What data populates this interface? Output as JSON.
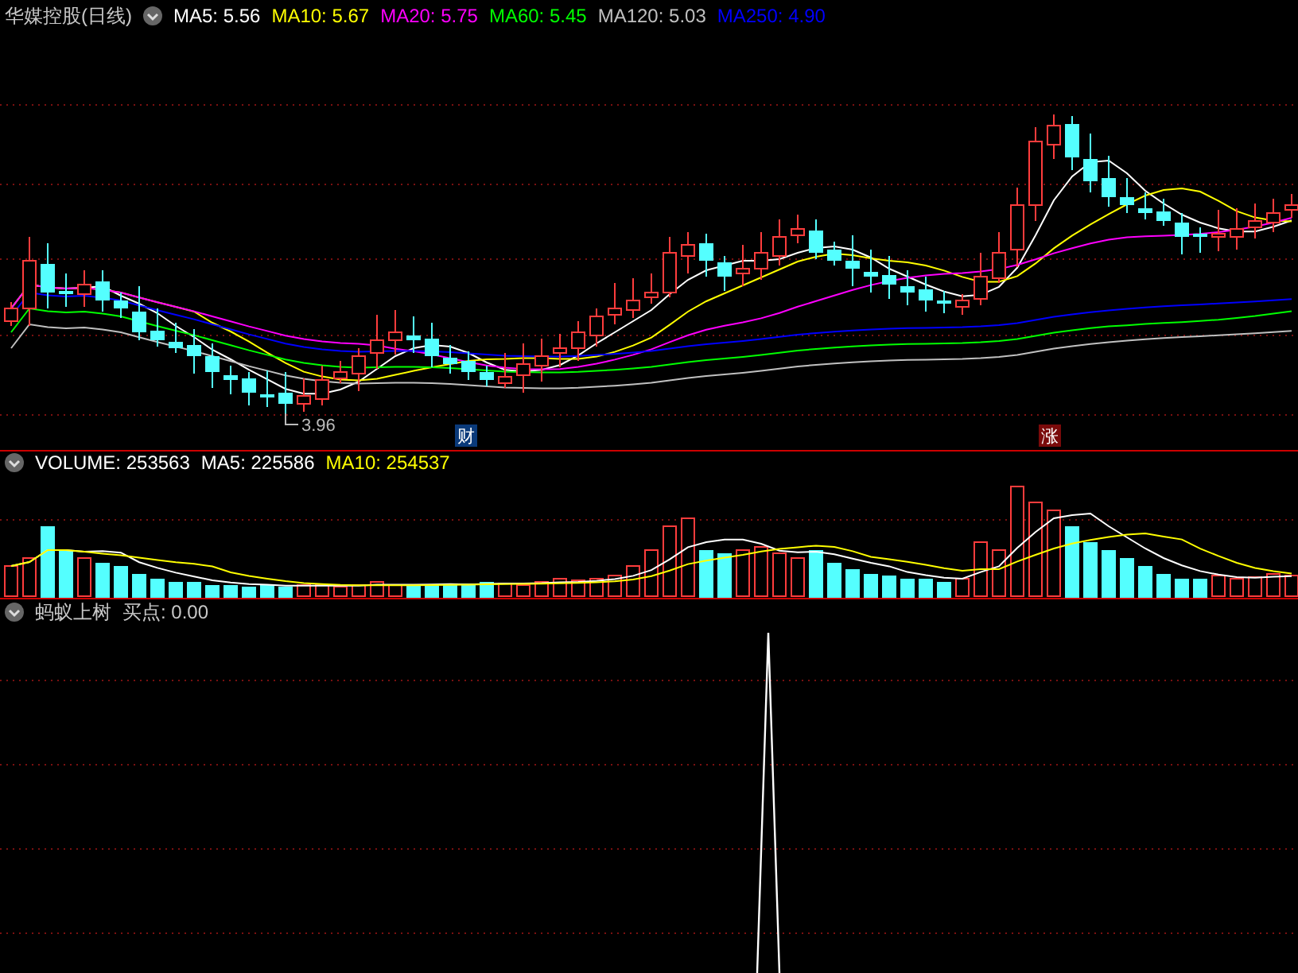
{
  "price_panel": {
    "title": "华媒控股(日线)",
    "indicators": [
      {
        "label": "MA5: 5.56",
        "color": "#ffffff"
      },
      {
        "label": "MA10: 5.67",
        "color": "#ffff00"
      },
      {
        "label": "MA20: 5.75",
        "color": "#ff00ff"
      },
      {
        "label": "MA60: 5.45",
        "color": "#00ff00"
      },
      {
        "label": "MA120: 5.03",
        "color": "#c0c0c0"
      },
      {
        "label": "MA250: 4.90",
        "color": "#0000ff"
      }
    ],
    "low_label": "3.96",
    "markers": [
      {
        "text": "财",
        "kind": "news"
      },
      {
        "text": "涨",
        "kind": "limit_up"
      }
    ]
  },
  "volume_panel": {
    "indicators": [
      {
        "label": "VOLUME: 253563",
        "color": "#ffffff"
      },
      {
        "label": "MA5: 225586",
        "color": "#ffffff"
      },
      {
        "label": "MA10: 254537",
        "color": "#ffff00"
      }
    ]
  },
  "signal_panel": {
    "title": "蚂蚁上树",
    "value": "买点: 0.00"
  }
}
